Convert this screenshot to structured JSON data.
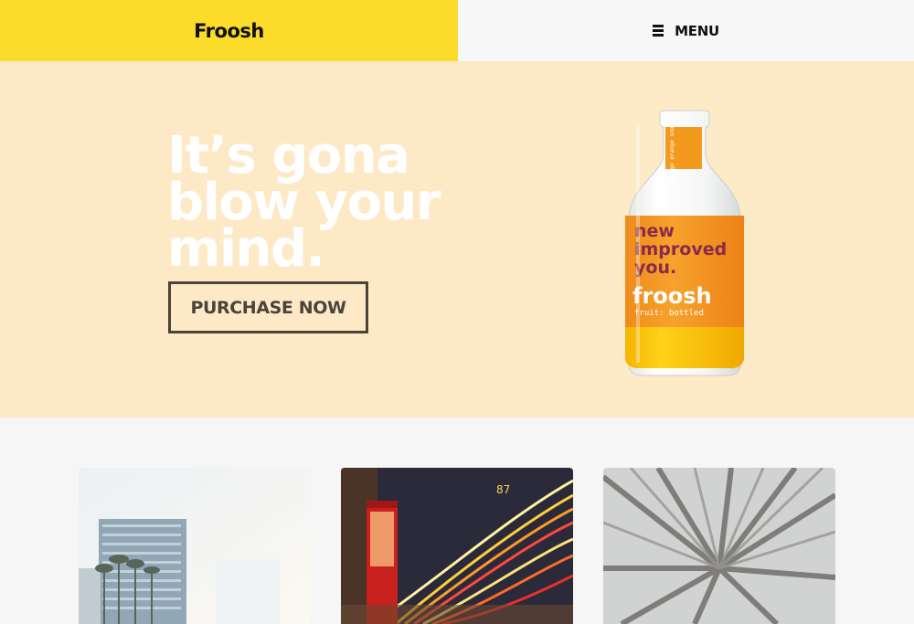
{
  "header": {
    "brand": "Froosh",
    "menu_label": "MENU",
    "menu_icon": "hamburger-icon"
  },
  "hero": {
    "headline": "It’s gona blow your mind.",
    "cta_label": "PURCHASE NOW",
    "product_image": {
      "label_cap": "mango orange smooth",
      "label_tagline_line1": "new",
      "label_tagline_line2": "improved",
      "label_tagline_line3": "you.",
      "label_brand": "froosh",
      "label_sub": "fruit: bottled"
    }
  },
  "cards": [
    {
      "name": "city-building-image"
    },
    {
      "name": "phone-booth-light-trails-image",
      "number_on_bus": "87"
    },
    {
      "name": "forest-canopy-image"
    }
  ],
  "colors": {
    "brand_yellow": "#fbdc2b",
    "hero_background": "#fde9c5",
    "cta_border": "#4a4339",
    "page_background": "#f6f6f6"
  }
}
